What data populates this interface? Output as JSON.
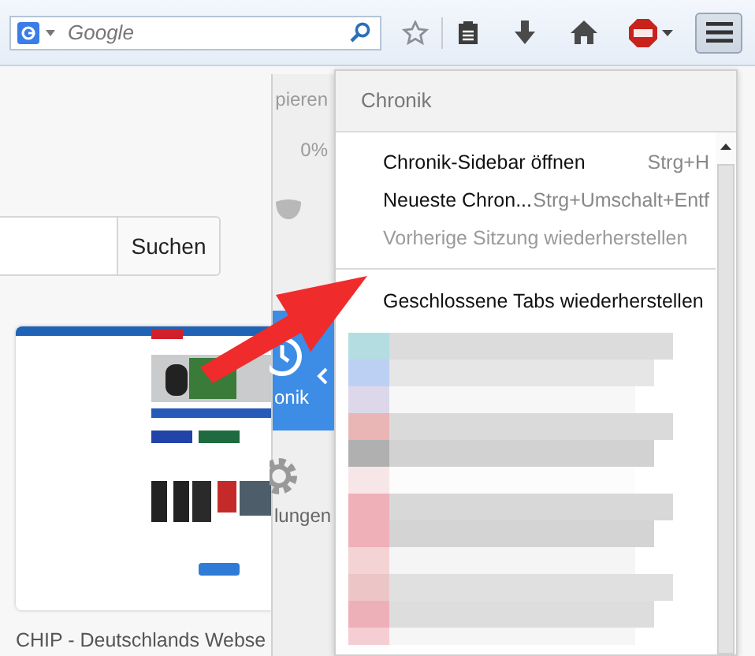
{
  "toolbar": {
    "search": {
      "placeholder": "Google"
    },
    "menu_button_pressed": true
  },
  "page": {
    "search_button": "Suchen",
    "thumbnail": {
      "kind": "picture",
      "caption": "CHIP - Deutschlands Webse"
    }
  },
  "main_menu": {
    "items": [
      {
        "kind": "text",
        "label": "pieren"
      },
      {
        "kind": "text",
        "label": "0%"
      },
      {
        "kind": "icon"
      },
      {
        "kind": "nav",
        "label": "onik",
        "selected": true
      },
      {
        "kind": "nav",
        "label": "lungen",
        "selected": false
      }
    ]
  },
  "history_panel": {
    "title": "Chronik",
    "items": [
      {
        "kind": "item",
        "label": "Chronik-Sidebar öffnen",
        "shortcut": "Strg+H",
        "disabled": false
      },
      {
        "kind": "item",
        "label": "Neueste Chron...",
        "shortcut": "Strg+Umschalt+Entf",
        "disabled": false
      },
      {
        "kind": "item",
        "label": "Vorherige Sitzung wiederherstellen",
        "disabled": true
      },
      {
        "kind": "separator"
      },
      {
        "kind": "item",
        "label": "Geschlossene Tabs wiederherstellen",
        "disabled": false
      }
    ]
  }
}
